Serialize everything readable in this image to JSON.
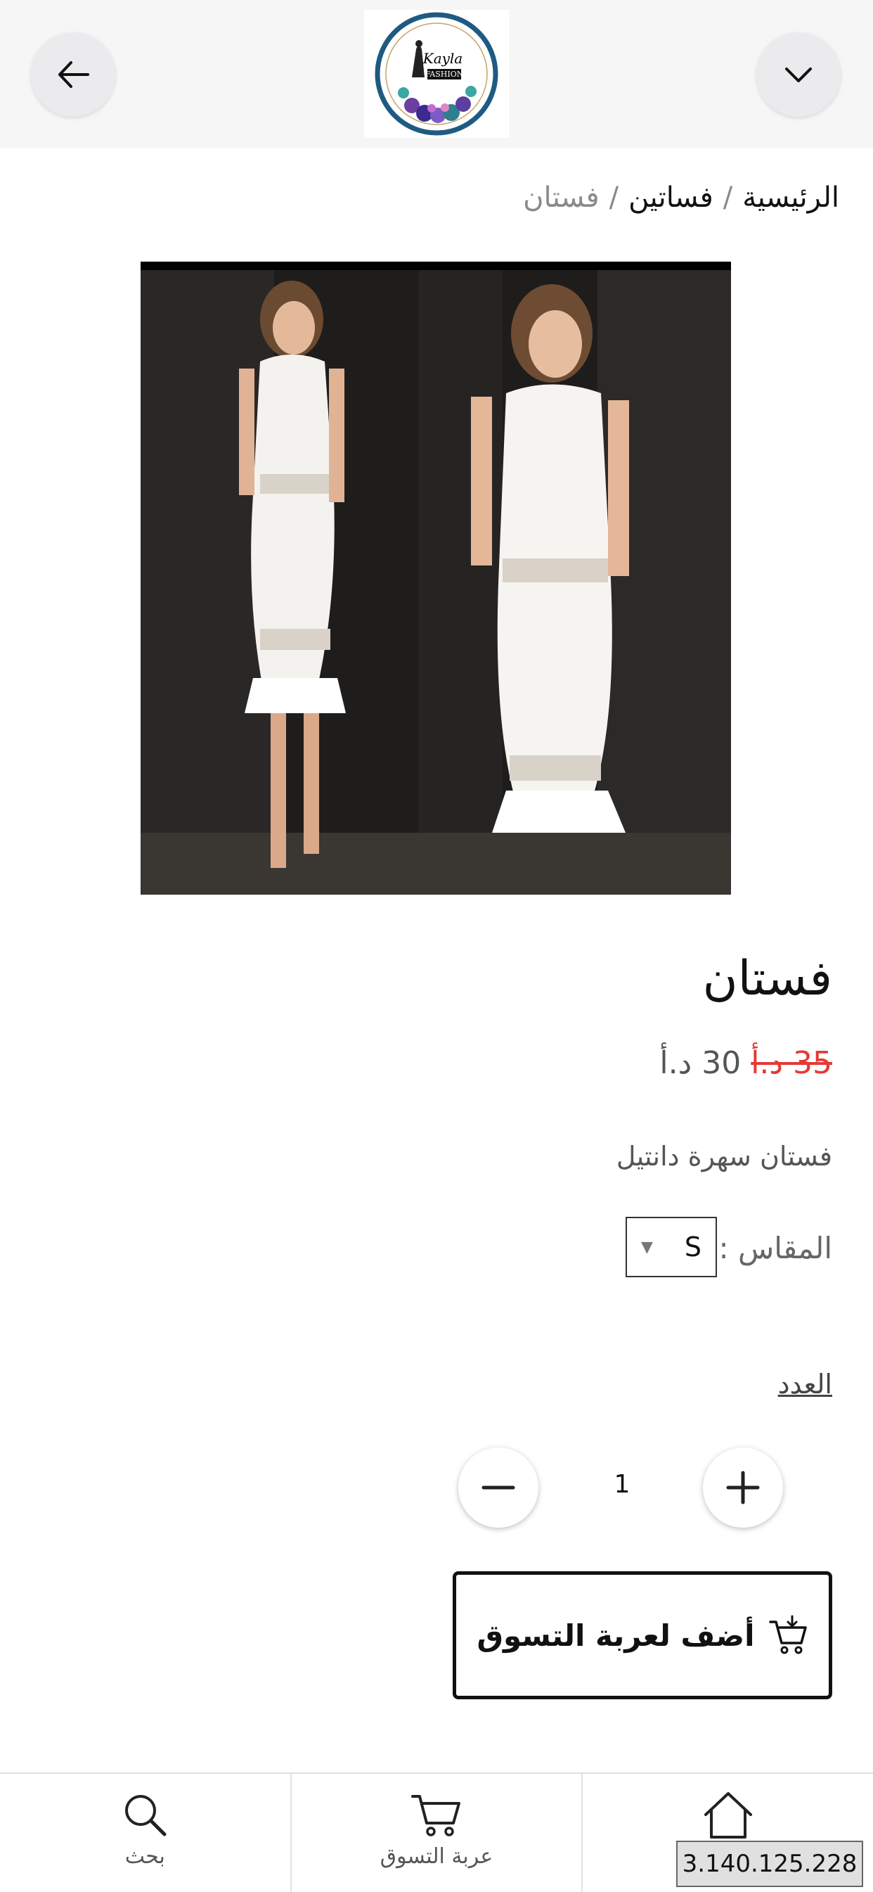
{
  "header": {
    "back_icon": "arrow-left-icon",
    "menu_icon": "chevron-down-icon",
    "logo": {
      "name": "Kayla",
      "sub": "FASHION"
    }
  },
  "breadcrumb": {
    "items": [
      "الرئيسية",
      "فساتين",
      "فستان"
    ],
    "separator": "/"
  },
  "product": {
    "title": "فستان",
    "old_price": "35 د.أ",
    "price": "30 د.أ",
    "description": "فستان سهرة دانتيل",
    "size_label": "المقاس :",
    "size_value": "S",
    "quantity_label": "العدد",
    "quantity": "1",
    "add_to_cart": "أضف لعربة التسوق"
  },
  "bottom_nav": {
    "items": [
      {
        "label": "بحث",
        "icon": "search-icon"
      },
      {
        "label": "عربة التسوق",
        "icon": "cart-icon"
      },
      {
        "label": "",
        "icon": "home-icon"
      }
    ]
  },
  "overlay": {
    "ip": "3.140.125.228"
  },
  "colors": {
    "sale": "#e53935",
    "header_bg": "#f6f6f6",
    "button_bg": "#ebebed"
  }
}
